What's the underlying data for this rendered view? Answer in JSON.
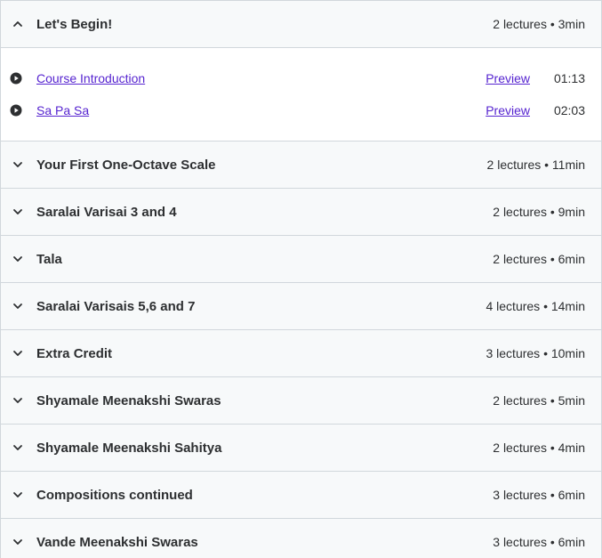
{
  "sections": [
    {
      "title": "Let's Begin!",
      "meta": "2 lectures • 3min",
      "expanded": true,
      "lectures": [
        {
          "title": "Course Introduction",
          "preview": "Preview",
          "duration": "01:13"
        },
        {
          "title": "Sa Pa Sa",
          "preview": "Preview",
          "duration": "02:03"
        }
      ]
    },
    {
      "title": "Your First One-Octave Scale",
      "meta": "2 lectures • 11min",
      "expanded": false
    },
    {
      "title": "Saralai Varisai 3 and 4",
      "meta": "2 lectures • 9min",
      "expanded": false
    },
    {
      "title": "Tala",
      "meta": "2 lectures • 6min",
      "expanded": false
    },
    {
      "title": "Saralai Varisais 5,6 and 7",
      "meta": "4 lectures • 14min",
      "expanded": false
    },
    {
      "title": "Extra Credit",
      "meta": "3 lectures • 10min",
      "expanded": false
    },
    {
      "title": "Shyamale Meenakshi Swaras",
      "meta": "2 lectures • 5min",
      "expanded": false
    },
    {
      "title": "Shyamale Meenakshi Sahitya",
      "meta": "2 lectures • 4min",
      "expanded": false
    },
    {
      "title": "Compositions continued",
      "meta": "3 lectures • 6min",
      "expanded": false
    },
    {
      "title": "Vande Meenakshi Swaras",
      "meta": "3 lectures • 6min",
      "expanded": false
    }
  ],
  "icons": {
    "expanded": "chevron-up-icon",
    "collapsed": "chevron-down-icon",
    "lecture": "play-circle-icon"
  },
  "colors": {
    "link": "#5624d0",
    "header_bg": "#f7f9fa",
    "border": "#d1d7dc",
    "text": "#2d2f31"
  }
}
